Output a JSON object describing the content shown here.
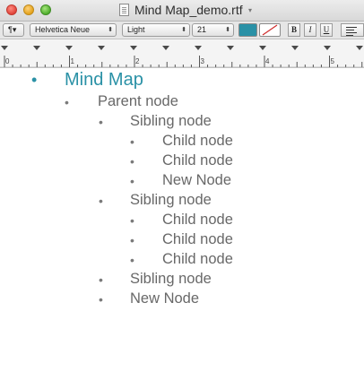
{
  "window": {
    "title": "Mind Map_demo.rtf",
    "title_menu_glyph": "▾"
  },
  "toolbar": {
    "paragraph_style": "¶▾",
    "font_family": "Helvetica Neue",
    "font_style": "Light",
    "font_size": "21",
    "text_color": "#2a91a6",
    "bold_label": "B",
    "italic_label": "I",
    "underline_label": "U",
    "popup_arrow": "⬍"
  },
  "ruler": {
    "numbers": [
      "0",
      "1",
      "2",
      "3",
      "4",
      "5"
    ]
  },
  "document": {
    "bullet_char": "•",
    "accent_color": "#2a91a6",
    "title": "Mind Map",
    "items": [
      {
        "level": 1,
        "text": "Parent node"
      },
      {
        "level": 2,
        "text": "Sibling node"
      },
      {
        "level": 3,
        "text": "Child node"
      },
      {
        "level": 3,
        "text": "Child node"
      },
      {
        "level": 3,
        "text": "New Node"
      },
      {
        "level": 2,
        "text": "Sibling node"
      },
      {
        "level": 3,
        "text": "Child node"
      },
      {
        "level": 3,
        "text": "Child node"
      },
      {
        "level": 3,
        "text": "Child node"
      },
      {
        "level": 2,
        "text": "Sibling node"
      },
      {
        "level": 2,
        "text": "New Node"
      }
    ]
  }
}
